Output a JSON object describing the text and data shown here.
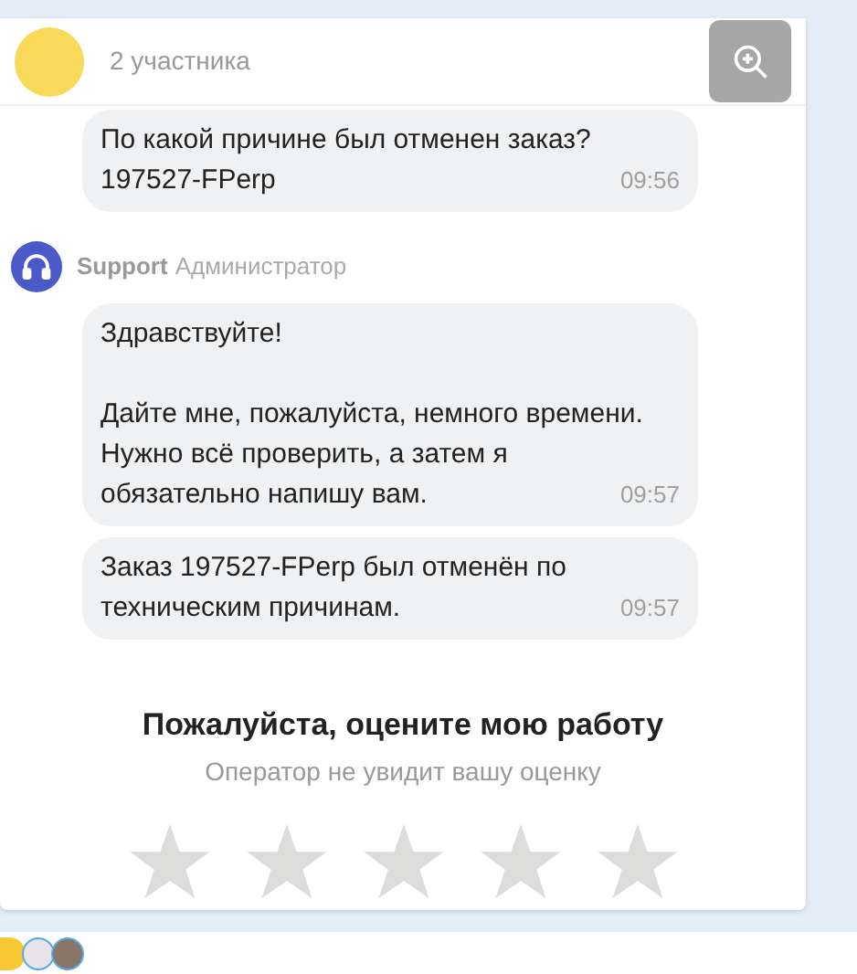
{
  "header": {
    "participants": "2 участника"
  },
  "messages": [
    {
      "kind": "own",
      "paragraphs": [
        [
          "По какой причине был отменен заказ?",
          "197527-FPerp"
        ]
      ],
      "time": "09:56"
    },
    {
      "kind": "author",
      "name": "Support",
      "role": "Администратор"
    },
    {
      "kind": "incoming",
      "paragraphs": [
        [
          "Здравствуйте!"
        ],
        [
          "Дайте мне, пожалуйста, немного времени.",
          "Нужно всё проверить, а затем я",
          "обязательно напишу вам."
        ]
      ],
      "time": "09:57"
    },
    {
      "kind": "incoming",
      "paragraphs": [
        [
          "Заказ 197527-FPerp был отменён по",
          "техническим причинам."
        ]
      ],
      "time": "09:57"
    }
  ],
  "rating": {
    "title": "Пожалуйста, оцените мою работу",
    "subtitle": "Оператор не увидит вашу оценку",
    "stars": 0
  }
}
